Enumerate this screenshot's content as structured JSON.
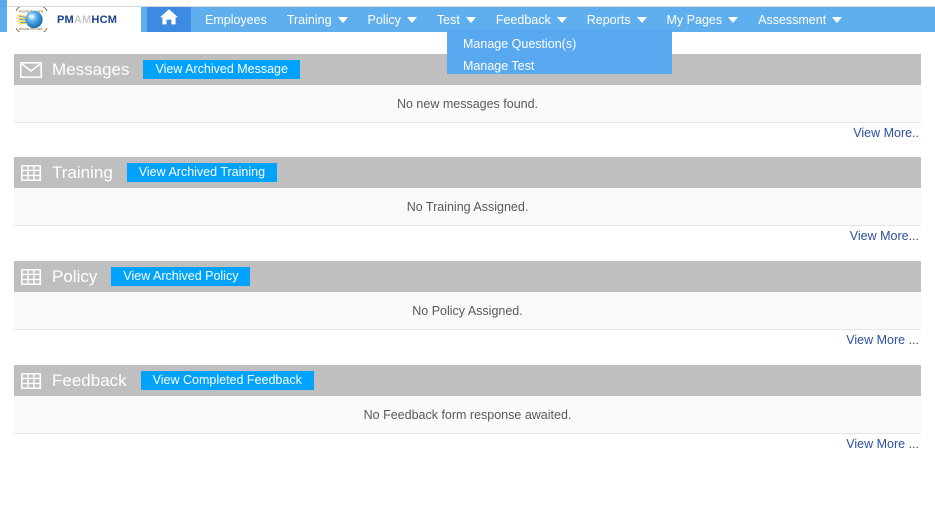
{
  "brand": {
    "logo_top_text": "Around the world",
    "logo_bottom_text": "Around the clock",
    "name_pm": "PM",
    "name_am": "AM",
    "name_hcm": "HCM",
    "logo_icon": "globe-icon"
  },
  "nav": {
    "home_icon": "home-icon",
    "items": [
      {
        "label": "Employees",
        "has_caret": false,
        "active": false
      },
      {
        "label": "Training",
        "has_caret": true,
        "active": false
      },
      {
        "label": "Policy",
        "has_caret": true,
        "active": false
      },
      {
        "label": "Test",
        "has_caret": true,
        "active": true
      },
      {
        "label": "Feedback",
        "has_caret": true,
        "active": false
      },
      {
        "label": "Reports",
        "has_caret": true,
        "active": false
      },
      {
        "label": "My Pages",
        "has_caret": true,
        "active": false
      },
      {
        "label": "Assessment",
        "has_caret": true,
        "active": false
      }
    ]
  },
  "dropdown": {
    "parent": "Test",
    "items": [
      {
        "label": "Manage Question(s)"
      },
      {
        "label": "Manage Test"
      }
    ]
  },
  "panels": [
    {
      "title": "Messages",
      "icon": "envelope-icon",
      "button_label": "View Archived Message",
      "message": "No new messages found.",
      "view_more_label": "View More.."
    },
    {
      "title": "Training",
      "icon": "grid-icon",
      "button_label": "View Archived Training",
      "message": "No Training Assigned.",
      "view_more_label": "View More..."
    },
    {
      "title": "Policy",
      "icon": "grid-icon",
      "button_label": "View Archived Policy",
      "message": "No Policy Assigned.",
      "view_more_label": "View More ..."
    },
    {
      "title": "Feedback",
      "icon": "grid-icon",
      "button_label": "View Completed Feedback",
      "message": "No Feedback form response awaited.",
      "view_more_label": "View More ..."
    }
  ],
  "colors": {
    "navbar_blue": "#5fafef",
    "home_blue": "#3c8ae2",
    "dropdown_blue": "#58a8f0",
    "panel_header_gray": "#bfbfbf",
    "button_blue": "#00a2ff",
    "link_blue": "#2c4f9e"
  }
}
